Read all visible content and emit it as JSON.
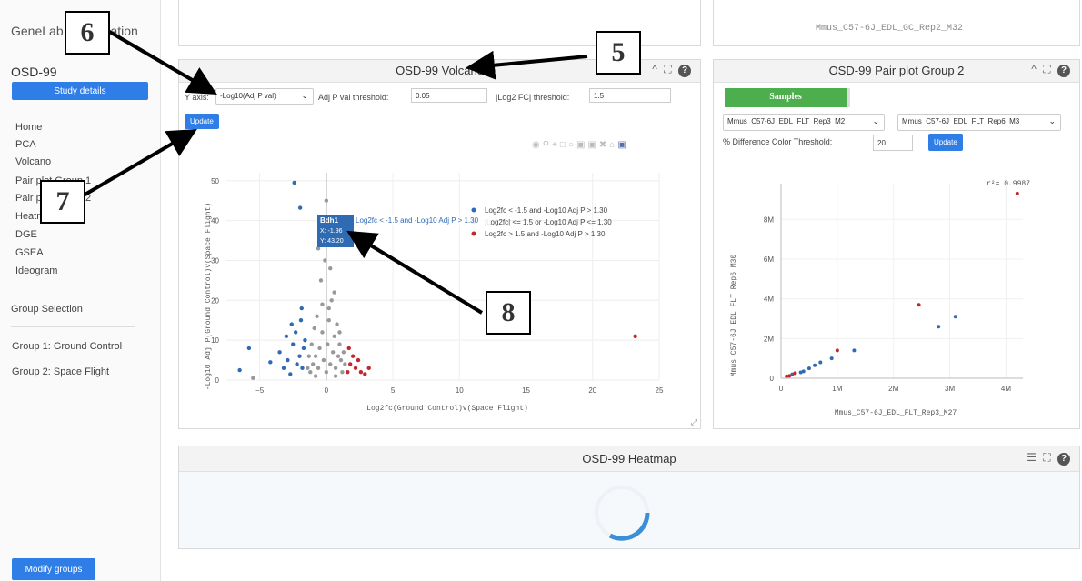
{
  "sidebar": {
    "app_title": "GeneLab Visualization",
    "dataset": "OSD-99",
    "study_details": "Study details",
    "nav": [
      "Home",
      "PCA",
      "Volcano",
      "Pair plot Group 1",
      "Pair plot Group 2",
      "Heatmap",
      "DGE",
      "GSEA",
      "Ideogram"
    ],
    "group_selection": "Group Selection",
    "groups": [
      "Group 1: Ground Control",
      "Group 2: Space Flight"
    ],
    "modify_groups": "Modify groups"
  },
  "top_panel_right": {
    "label": "Mmus_C57-6J_EDL_GC_Rep2_M32"
  },
  "volcano": {
    "title": "OSD-99 Volcano",
    "y_axis_label": "Y axis:",
    "y_axis_value": "-Log10(Adj P val)",
    "adj_p_label": "Adj P val threshold:",
    "adj_p_value": "0.05",
    "log2fc_label": "|Log2 FC| threshold:",
    "log2fc_value": "1.5",
    "update": "Update",
    "legend": [
      "Log2fc < -1.5 and -Log10 Adj P > 1.30",
      "|Log2fc| <= 1.5 or -Log10 Adj P <= 1.30",
      "Log2fc > 1.5 and -Log10 Adj P > 1.30"
    ],
    "legend_colors": [
      "#2f6bb3",
      "#999999",
      "#c0282d"
    ],
    "tooltip": {
      "gene": "Bdh1",
      "x": "X: -1.96",
      "y": "Y: 43.20",
      "text": "Log2fc < -1.5 and -Log10 Adj P > 1.30"
    },
    "xlabel": "Log2fc(Ground Control)v(Space Flight)",
    "ylabel": "-Log10 Adj P(Ground Control)v(Space Flight)"
  },
  "pairplot": {
    "title": "OSD-99 Pair plot Group 2",
    "samples_tab": "Samples",
    "sample_x": "Mmus_C57-6J_EDL_FLT_Rep3_M2",
    "sample_y": "Mmus_C57-6J_EDL_FLT_Rep6_M3",
    "threshold_label": "% Difference Color Threshold:",
    "threshold_value": "20",
    "update": "Update",
    "r2": "r²= 0.9987",
    "xlabel": "Mmus_C57-6J_EDL_FLT_Rep3_M27",
    "ylabel": "Mmus_C57-6J_EDL_FLT_Rep6_M30"
  },
  "heatmap": {
    "title": "OSD-99 Heatmap"
  },
  "callouts": [
    "5",
    "6",
    "7",
    "8"
  ],
  "chart_data": [
    {
      "type": "scatter",
      "title": "",
      "xlabel": "Log2fc(Ground Control)v(Space Flight)",
      "ylabel": "-Log10 Adj P(Ground Control)v(Space Flight)",
      "xlim": [
        -7.5,
        25
      ],
      "ylim": [
        0,
        52
      ],
      "xticks": [
        -5,
        0,
        5,
        10,
        15,
        20,
        25
      ],
      "yticks": [
        0,
        10,
        20,
        30,
        40,
        50
      ],
      "series": [
        {
          "name": "Log2fc < -1.5 and -Log10 Adj P > 1.30",
          "color": "#2f6bb3",
          "points": [
            [
              -6.5,
              2.5
            ],
            [
              -5.8,
              8
            ],
            [
              -4.2,
              4.5
            ],
            [
              -3.5,
              7
            ],
            [
              -3.2,
              3
            ],
            [
              -2.9,
              5
            ],
            [
              -2.7,
              1.5
            ],
            [
              -2.5,
              9
            ],
            [
              -2.3,
              12
            ],
            [
              -2.2,
              4
            ],
            [
              -2.0,
              6
            ],
            [
              -1.96,
              43.2
            ],
            [
              -1.9,
              15
            ],
            [
              -1.8,
              3
            ],
            [
              -1.7,
              8
            ],
            [
              -1.6,
              10
            ],
            [
              -2.4,
              49.5
            ],
            [
              -3.0,
              11
            ],
            [
              -2.6,
              14
            ],
            [
              -1.85,
              18
            ]
          ]
        },
        {
          "name": "|Log2fc| <= 1.5 or -Log10 Adj P <= 1.30",
          "color": "#999999",
          "points": [
            [
              -5.5,
              0.5
            ],
            [
              -1.2,
              2
            ],
            [
              -1.0,
              4
            ],
            [
              -0.8,
              6
            ],
            [
              -0.6,
              3
            ],
            [
              -0.5,
              8
            ],
            [
              -0.3,
              12
            ],
            [
              -0.2,
              5
            ],
            [
              0.0,
              2
            ],
            [
              0.1,
              9
            ],
            [
              0.2,
              15
            ],
            [
              0.3,
              4
            ],
            [
              0.4,
              20
            ],
            [
              0.5,
              7
            ],
            [
              0.6,
              11
            ],
            [
              0.7,
              3
            ],
            [
              0.8,
              14
            ],
            [
              0.9,
              6
            ],
            [
              1.0,
              9
            ],
            [
              1.1,
              5
            ],
            [
              1.2,
              2
            ],
            [
              1.3,
              7
            ],
            [
              1.4,
              4
            ],
            [
              -0.4,
              25
            ],
            [
              -0.1,
              30
            ],
            [
              0.3,
              28
            ],
            [
              -0.6,
              33
            ],
            [
              0.5,
              35
            ],
            [
              -0.2,
              38
            ],
            [
              0.0,
              45
            ],
            [
              -1.1,
              9
            ],
            [
              -0.9,
              13
            ],
            [
              0.2,
              18
            ],
            [
              -0.7,
              16
            ],
            [
              1.0,
              12
            ],
            [
              -1.3,
              6
            ],
            [
              -1.4,
              3
            ],
            [
              0.6,
              22
            ],
            [
              -0.3,
              19
            ],
            [
              0.7,
              1
            ],
            [
              -0.8,
              1
            ]
          ]
        },
        {
          "name": "Log2fc > 1.5 and -Log10 Adj P > 1.30",
          "color": "#c0282d",
          "points": [
            [
              1.6,
              2
            ],
            [
              1.8,
              4
            ],
            [
              2.0,
              6
            ],
            [
              2.2,
              3
            ],
            [
              2.4,
              5
            ],
            [
              2.6,
              2
            ],
            [
              2.9,
              1.5
            ],
            [
              3.2,
              3
            ],
            [
              1.7,
              8
            ],
            [
              23.2,
              11
            ]
          ]
        }
      ]
    },
    {
      "type": "scatter",
      "title": "",
      "xlabel": "Mmus_C57-6J_EDL_FLT_Rep3_M27",
      "ylabel": "Mmus_C57-6J_EDL_FLT_Rep6_M30",
      "xlim": [
        0,
        4300000
      ],
      "ylim": [
        0,
        9800000
      ],
      "xticks": [
        "0",
        "1M",
        "2M",
        "3M",
        "4M"
      ],
      "yticks": [
        "0",
        "2M",
        "4M",
        "6M",
        "8M"
      ],
      "series": [
        {
          "name": "down",
          "color": "#2f6bb3",
          "points": [
            [
              200000,
              200000
            ],
            [
              350000,
              300000
            ],
            [
              500000,
              500000
            ],
            [
              700000,
              800000
            ],
            [
              900000,
              1000000
            ],
            [
              1300000,
              1400000
            ],
            [
              3100000,
              3100000
            ],
            [
              2800000,
              2600000
            ],
            [
              400000,
              350000
            ],
            [
              600000,
              650000
            ]
          ]
        },
        {
          "name": "up",
          "color": "#c0282d",
          "points": [
            [
              100000,
              100000
            ],
            [
              150000,
              120000
            ],
            [
              250000,
              260000
            ],
            [
              1000000,
              1400000
            ],
            [
              2450000,
              3700000
            ],
            [
              4200000,
              9300000
            ]
          ]
        }
      ]
    }
  ]
}
